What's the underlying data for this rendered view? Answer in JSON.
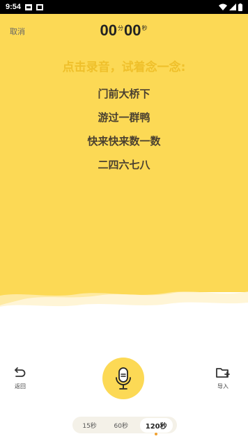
{
  "status_bar": {
    "time": "9:54"
  },
  "header": {
    "cancel_label": "取消"
  },
  "timer": {
    "minutes": "00",
    "minute_unit": "分",
    "seconds": "00",
    "second_unit": "秒"
  },
  "prompt": "点击录音，试着念一念:",
  "poem_lines": [
    "门前大桥下",
    "游过一群鸭",
    "快来快来数一数",
    "二四六七八"
  ],
  "controls": {
    "back_label": "返回",
    "import_label": "导入"
  },
  "durations": [
    "15秒",
    "60秒",
    "120秒"
  ],
  "selected_duration": "120秒",
  "colors": {
    "accent_yellow": "#fcd955",
    "prompt_gold": "#efc02b",
    "active_dot": "#f0a030"
  }
}
